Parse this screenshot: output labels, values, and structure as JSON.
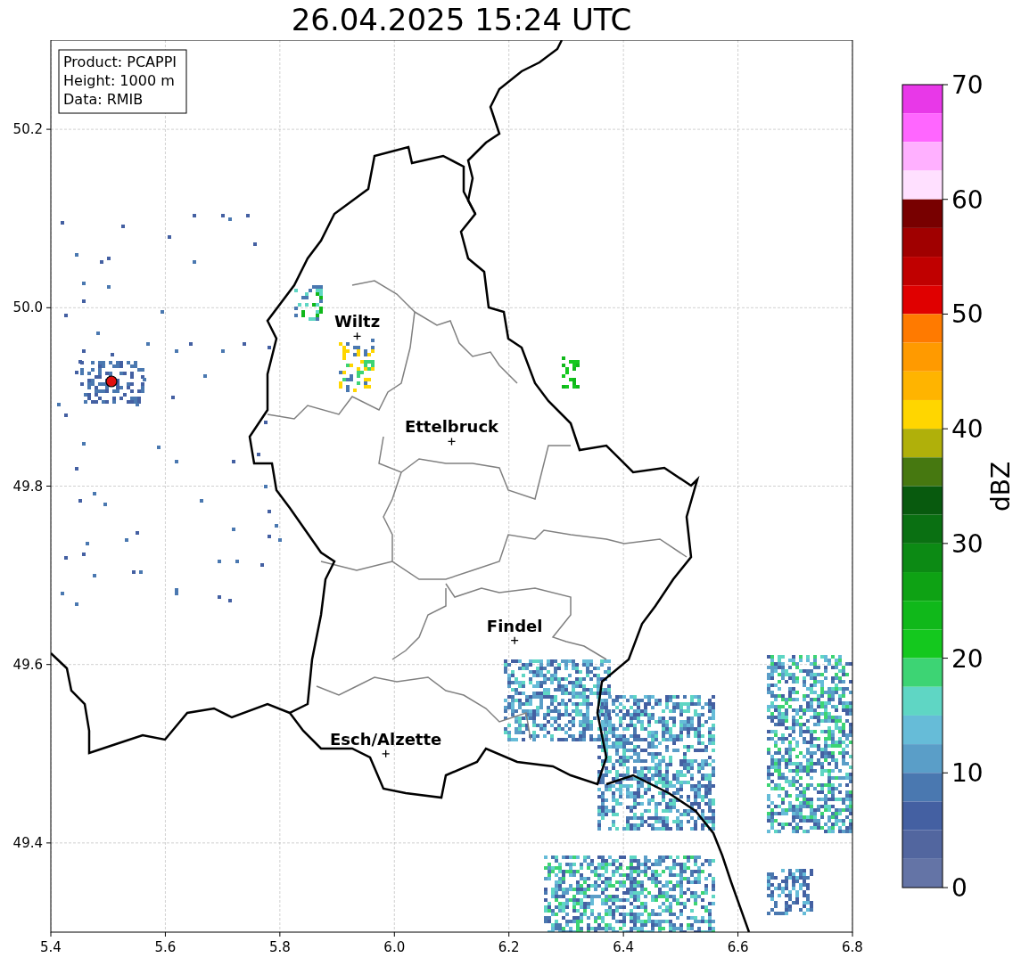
{
  "title": "26.04.2025 15:24 UTC",
  "info_box": [
    "Product: PCAPPI",
    "Height: 1000 m",
    "Data: RMIB"
  ],
  "cities": [
    "Wiltz",
    "Ettelbruck",
    "Findel",
    "Esch/Alzette"
  ],
  "xticks": [
    "5.4",
    "5.6",
    "5.8",
    "6.0",
    "6.2",
    "6.4",
    "6.6",
    "6.8"
  ],
  "yticks": [
    "50.2",
    "50.0",
    "49.8",
    "49.6",
    "49.4"
  ],
  "colorbar": {
    "label": "dBZ",
    "ticks": [
      "70",
      "60",
      "50",
      "40",
      "30",
      "20",
      "10",
      "0"
    ],
    "bands": [
      {
        "color": "#e838e8"
      },
      {
        "color": "#ff66ff"
      },
      {
        "color": "#ffb0ff"
      },
      {
        "color": "#ffe0ff"
      },
      {
        "color": "#780000"
      },
      {
        "color": "#a00000"
      },
      {
        "color": "#c00000"
      },
      {
        "color": "#e00000"
      },
      {
        "color": "#ff7a00"
      },
      {
        "color": "#ff9a00"
      },
      {
        "color": "#ffb400"
      },
      {
        "color": "#ffd600"
      },
      {
        "color": "#b0b00a"
      },
      {
        "color": "#467810"
      },
      {
        "color": "#085a0e"
      },
      {
        "color": "#0a7012"
      },
      {
        "color": "#0c8a14"
      },
      {
        "color": "#0ea214"
      },
      {
        "color": "#10b81a"
      },
      {
        "color": "#14c81e"
      },
      {
        "color": "#3dd474"
      },
      {
        "color": "#5fd6c4"
      },
      {
        "color": "#66bcd8"
      },
      {
        "color": "#5a9ec8"
      },
      {
        "color": "#4a78b0"
      },
      {
        "color": "#4460a2"
      },
      {
        "color": "#52669f"
      },
      {
        "color": "#6474a6"
      }
    ]
  }
}
